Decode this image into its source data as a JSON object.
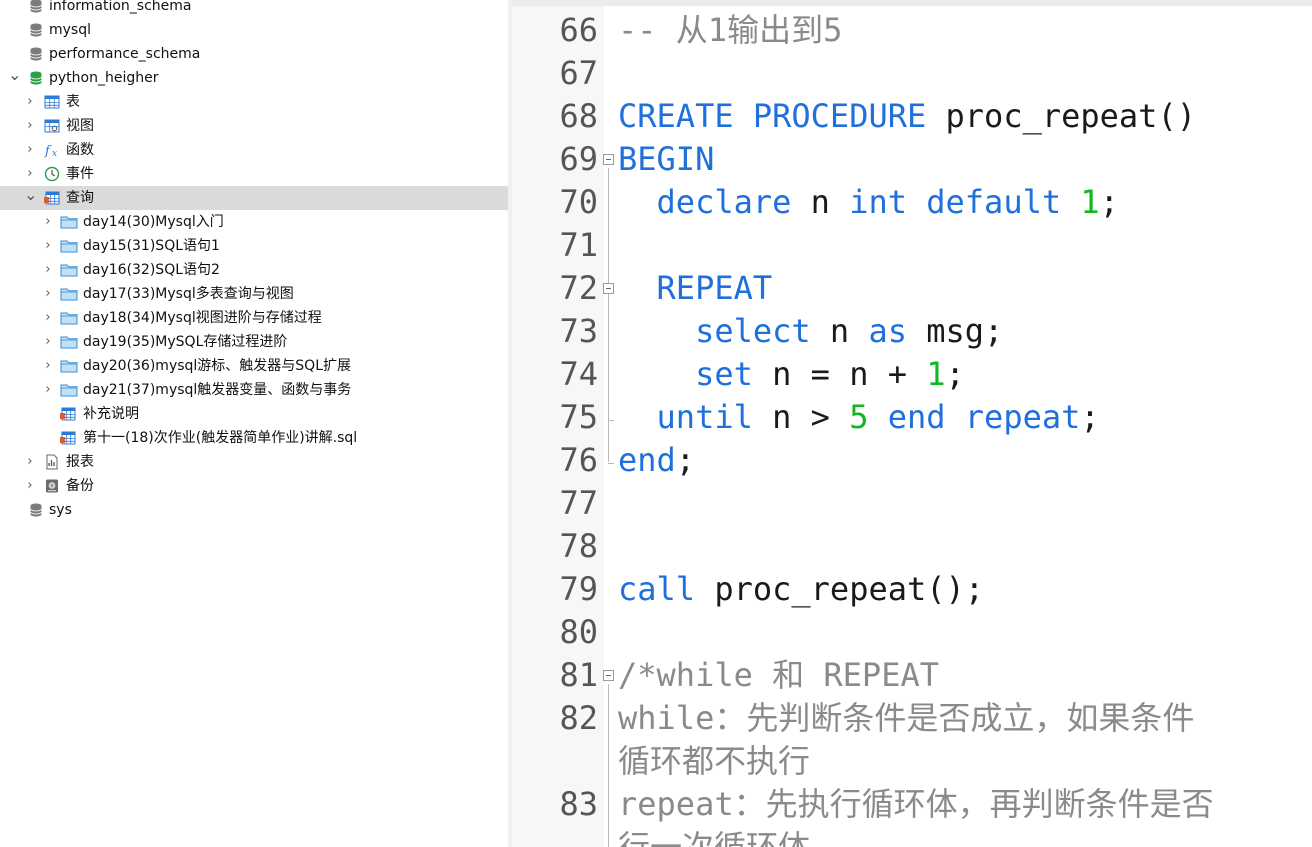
{
  "tree": [
    {
      "label": "information_schema",
      "icon": "database-icon",
      "level": 1
    },
    {
      "label": "mysql",
      "icon": "database-icon",
      "level": 1
    },
    {
      "label": "performance_schema",
      "icon": "database-icon",
      "level": 1
    },
    {
      "label": "python_heigher",
      "icon": "database-open-icon",
      "level": 1,
      "expanded": true
    },
    {
      "label": "表",
      "icon": "table-icon",
      "level": 2
    },
    {
      "label": "视图",
      "icon": "view-icon",
      "level": 2
    },
    {
      "label": "函数",
      "icon": "function-icon",
      "level": 2
    },
    {
      "label": "事件",
      "icon": "event-clock-icon",
      "level": 2
    },
    {
      "label": "查询",
      "icon": "query-icon",
      "level": 2,
      "expanded": true,
      "selected": true
    },
    {
      "label": "day14(30)Mysql入门",
      "icon": "folder-icon",
      "level": 3
    },
    {
      "label": "day15(31)SQL语句1",
      "icon": "folder-icon",
      "level": 3
    },
    {
      "label": "day16(32)SQL语句2",
      "icon": "folder-icon",
      "level": 3
    },
    {
      "label": "day17(33)Mysql多表查询与视图",
      "icon": "folder-icon",
      "level": 3
    },
    {
      "label": "day18(34)Mysql视图进阶与存储过程",
      "icon": "folder-icon",
      "level": 3
    },
    {
      "label": "day19(35)MySQL存储过程进阶",
      "icon": "folder-icon",
      "level": 3
    },
    {
      "label": "day20(36)mysql游标、触发器与SQL扩展",
      "icon": "folder-icon",
      "level": 3
    },
    {
      "label": "day21(37)mysql触发器变量、函数与事务",
      "icon": "folder-icon",
      "level": 3
    },
    {
      "label": "补充说明",
      "icon": "query-file-icon",
      "level": 3
    },
    {
      "label": "第十一(18)次作业(触发器简单作业)讲解.sql",
      "icon": "query-file-icon",
      "level": 3
    },
    {
      "label": "报表",
      "icon": "report-icon",
      "level": 2
    },
    {
      "label": "备份",
      "icon": "backup-icon",
      "level": 2
    },
    {
      "label": "sys",
      "icon": "database-icon",
      "level": 1
    }
  ],
  "editor": {
    "lines": [
      {
        "n": "66",
        "parts": [
          {
            "t": "-- 从1输出到5",
            "c": "cm"
          }
        ]
      },
      {
        "n": "67",
        "parts": []
      },
      {
        "n": "68",
        "parts": [
          {
            "t": "CREATE PROCEDURE",
            "c": "kw"
          },
          {
            "t": " proc_repeat()",
            "c": ""
          }
        ]
      },
      {
        "n": "69",
        "parts": [
          {
            "t": "BEGIN",
            "c": "kw"
          }
        ]
      },
      {
        "n": "70",
        "parts": [
          {
            "t": "  ",
            "c": ""
          },
          {
            "t": "declare",
            "c": "kw"
          },
          {
            "t": " n ",
            "c": ""
          },
          {
            "t": "int",
            "c": "kw"
          },
          {
            "t": " ",
            "c": ""
          },
          {
            "t": "default",
            "c": "kw"
          },
          {
            "t": " ",
            "c": ""
          },
          {
            "t": "1",
            "c": "num"
          },
          {
            "t": ";",
            "c": ""
          }
        ]
      },
      {
        "n": "71",
        "parts": []
      },
      {
        "n": "72",
        "parts": [
          {
            "t": "  ",
            "c": ""
          },
          {
            "t": "REPEAT",
            "c": "kw"
          }
        ]
      },
      {
        "n": "73",
        "parts": [
          {
            "t": "    ",
            "c": ""
          },
          {
            "t": "select",
            "c": "kw"
          },
          {
            "t": " n ",
            "c": ""
          },
          {
            "t": "as",
            "c": "kw"
          },
          {
            "t": " msg;",
            "c": ""
          }
        ]
      },
      {
        "n": "74",
        "parts": [
          {
            "t": "    ",
            "c": ""
          },
          {
            "t": "set",
            "c": "kw"
          },
          {
            "t": " n = n + ",
            "c": ""
          },
          {
            "t": "1",
            "c": "num"
          },
          {
            "t": ";",
            "c": ""
          }
        ]
      },
      {
        "n": "75",
        "parts": [
          {
            "t": "  ",
            "c": ""
          },
          {
            "t": "until",
            "c": "kw"
          },
          {
            "t": " n > ",
            "c": ""
          },
          {
            "t": "5",
            "c": "num"
          },
          {
            "t": " ",
            "c": ""
          },
          {
            "t": "end repeat",
            "c": "kw"
          },
          {
            "t": ";",
            "c": ""
          }
        ]
      },
      {
        "n": "76",
        "parts": [
          {
            "t": "end",
            "c": "kw"
          },
          {
            "t": ";",
            "c": ""
          }
        ]
      },
      {
        "n": "77",
        "parts": []
      },
      {
        "n": "78",
        "parts": []
      },
      {
        "n": "79",
        "parts": [
          {
            "t": "call",
            "c": "kw"
          },
          {
            "t": " proc_repeat();",
            "c": ""
          }
        ]
      },
      {
        "n": "80",
        "parts": []
      },
      {
        "n": "81",
        "parts": [
          {
            "t": "/*while 和 REPEAT",
            "c": "cm"
          }
        ]
      },
      {
        "n": "82",
        "parts": [
          {
            "t": "while：先判断条件是否成立，如果条件",
            "c": "cm"
          }
        ]
      },
      {
        "n": "",
        "parts": [
          {
            "t": "循环都不执行",
            "c": "cm"
          }
        ]
      },
      {
        "n": "83",
        "parts": [
          {
            "t": "repeat：先执行循环体，再判断条件是否",
            "c": "cm"
          }
        ]
      },
      {
        "n": "",
        "parts": [
          {
            "t": "行一次循环体",
            "c": "cm"
          }
        ]
      }
    ]
  }
}
